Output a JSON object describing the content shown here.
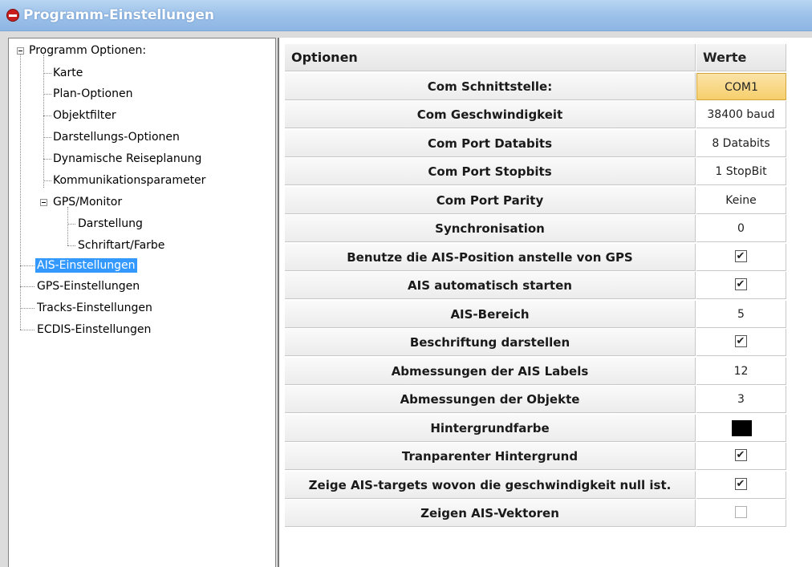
{
  "window": {
    "title": "Programm-Einstellungen"
  },
  "tree": {
    "items": [
      {
        "label": "Programm Optionen:",
        "name": "tree-item-programm-optionen"
      },
      {
        "label": "Karte",
        "name": "tree-item-karte"
      },
      {
        "label": "Plan-Optionen",
        "name": "tree-item-plan-optionen"
      },
      {
        "label": "Objektfilter",
        "name": "tree-item-objektfilter"
      },
      {
        "label": "Darstellungs-Optionen",
        "name": "tree-item-darstellungs-optionen"
      },
      {
        "label": "Dynamische Reiseplanung",
        "name": "tree-item-dynamische-reiseplanung"
      },
      {
        "label": "Kommunikationsparameter",
        "name": "tree-item-kommunikationsparameter"
      },
      {
        "label": "GPS/Monitor",
        "name": "tree-item-gps-monitor"
      },
      {
        "label": "Darstellung",
        "name": "tree-item-darstellung"
      },
      {
        "label": "Schriftart/Farbe",
        "name": "tree-item-schriftart-farbe"
      },
      {
        "label": "AIS-Einstellungen",
        "name": "tree-item-ais-einstellungen"
      },
      {
        "label": "GPS-Einstellungen",
        "name": "tree-item-gps-einstellungen"
      },
      {
        "label": "Tracks-Einstellungen",
        "name": "tree-item-tracks-einstellungen"
      },
      {
        "label": "ECDIS-Einstellungen",
        "name": "tree-item-ecdis-einstellungen"
      }
    ],
    "selected": "AIS-Einstellungen"
  },
  "grid": {
    "header": {
      "options": "Optionen",
      "values": "Werte"
    },
    "rows": [
      {
        "option": "Com Schnittstelle:",
        "value": "COM1",
        "kind": "text",
        "focused": true
      },
      {
        "option": "Com Geschwindigkeit",
        "value": "38400 baud",
        "kind": "text"
      },
      {
        "option": "Com Port Databits",
        "value": "8 Databits",
        "kind": "text"
      },
      {
        "option": "Com Port Stopbits",
        "value": "1 StopBit",
        "kind": "text"
      },
      {
        "option": "Com Port Parity",
        "value": "Keine",
        "kind": "text"
      },
      {
        "option": "Synchronisation",
        "value": "0",
        "kind": "text"
      },
      {
        "option": "Benutze die AIS-Position anstelle von GPS",
        "value": true,
        "kind": "check"
      },
      {
        "option": "AIS automatisch starten",
        "value": true,
        "kind": "check"
      },
      {
        "option": "AIS-Bereich",
        "value": "5",
        "kind": "text"
      },
      {
        "option": "Beschriftung darstellen",
        "value": true,
        "kind": "check"
      },
      {
        "option": "Abmessungen der AIS Labels",
        "value": "12",
        "kind": "text"
      },
      {
        "option": "Abmessungen der Objekte",
        "value": "3",
        "kind": "text"
      },
      {
        "option": "Hintergrundfarbe",
        "value": "#000000",
        "kind": "color"
      },
      {
        "option": "Tranparenter Hintergrund",
        "value": true,
        "kind": "check"
      },
      {
        "option": "Zeige AIS-targets wovon die geschwindigkeit null ist.",
        "value": true,
        "kind": "check"
      },
      {
        "option": "Zeigen AIS-Vektoren",
        "value": false,
        "kind": "check"
      }
    ]
  },
  "colors": {
    "titlebar": "#9fc3ea",
    "selection": "#3399ff",
    "focused_cell": "#f6cf6c"
  }
}
